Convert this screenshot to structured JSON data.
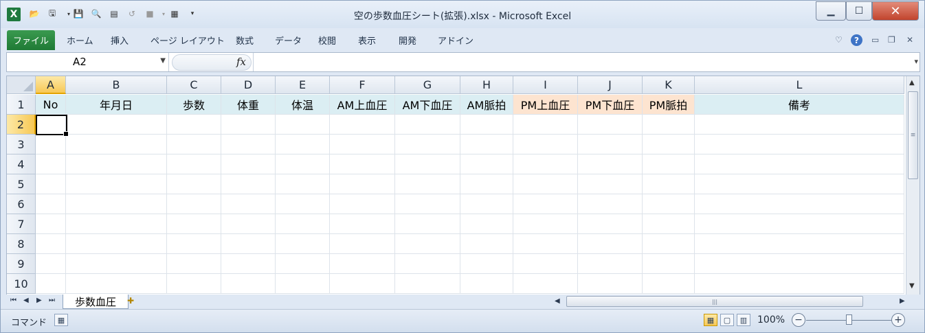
{
  "window": {
    "title": "空の歩数血圧シート(拡張).xlsx  -  Microsoft Excel"
  },
  "ribbon": {
    "file_tab": "ファイル",
    "tabs": [
      "ホーム",
      "挿入",
      "ページ レイアウト",
      "数式",
      "データ",
      "校閲",
      "表示",
      "開発",
      "アドイン"
    ]
  },
  "formula_bar": {
    "name_box": "A2",
    "fx_label": "fx",
    "formula": ""
  },
  "sheet": {
    "columns": [
      "A",
      "B",
      "C",
      "D",
      "E",
      "F",
      "G",
      "H",
      "I",
      "J",
      "K",
      "L"
    ],
    "selected_column": "A",
    "rows": [
      "1",
      "2",
      "3",
      "4",
      "5",
      "6",
      "7",
      "8",
      "9",
      "10"
    ],
    "selected_row": "2",
    "active_cell": "A2",
    "header_row": [
      "No",
      "年月日",
      "歩数",
      "体重",
      "体温",
      "AM上血圧",
      "AM下血圧",
      "AM脈拍",
      "PM上血圧",
      "PM下血圧",
      "PM脈拍",
      "備考"
    ],
    "header_fill": {
      "blue": "#dbeef3",
      "orange": "#fde4d0"
    }
  },
  "sheet_tabs": {
    "active": "歩数血圧"
  },
  "status_bar": {
    "mode": "コマンド",
    "zoom": "100%"
  },
  "colors": {
    "file_tab": "#1f7a35",
    "selection_header": "#f7c855",
    "close_button": "#c1442d"
  }
}
